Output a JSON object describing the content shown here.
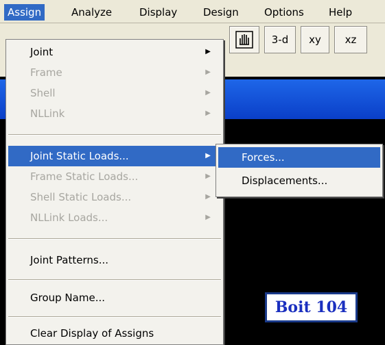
{
  "menubar": {
    "items": [
      "Assign",
      "Analyze",
      "Display",
      "Design",
      "Options",
      "Help"
    ]
  },
  "toolbar": {
    "pan_icon": "hand-icon",
    "view_3d": "3-d",
    "view_xy": "xy",
    "view_xz": "xz"
  },
  "assign_menu": {
    "items": [
      {
        "label": "Joint",
        "enabled": true,
        "submenu": true
      },
      {
        "label": "Frame",
        "enabled": false,
        "submenu": true
      },
      {
        "label": "Shell",
        "enabled": false,
        "submenu": true
      },
      {
        "label": "NLLink",
        "enabled": false,
        "submenu": true
      },
      {
        "label": "Joint Static Loads...",
        "enabled": true,
        "submenu": true,
        "highlighted": true
      },
      {
        "label": "Frame Static Loads...",
        "enabled": false,
        "submenu": true
      },
      {
        "label": "Shell Static Loads...",
        "enabled": false,
        "submenu": true
      },
      {
        "label": "NLLink Loads...",
        "enabled": false,
        "submenu": true
      },
      {
        "label": "Joint Patterns...",
        "enabled": true
      },
      {
        "label": "Group Name...",
        "enabled": true
      },
      {
        "label": "Clear Display of Assigns",
        "enabled": true
      }
    ]
  },
  "joint_static_loads_submenu": {
    "items": [
      {
        "label": "Forces...",
        "highlighted": true
      },
      {
        "label": "Displacements..."
      }
    ]
  },
  "caption": "Boit 104",
  "colors": {
    "highlight": "#316ac5",
    "menu_bg": "#f3f2ed",
    "title_band": "#1e66e8",
    "caption_text": "#1a2fbf"
  }
}
